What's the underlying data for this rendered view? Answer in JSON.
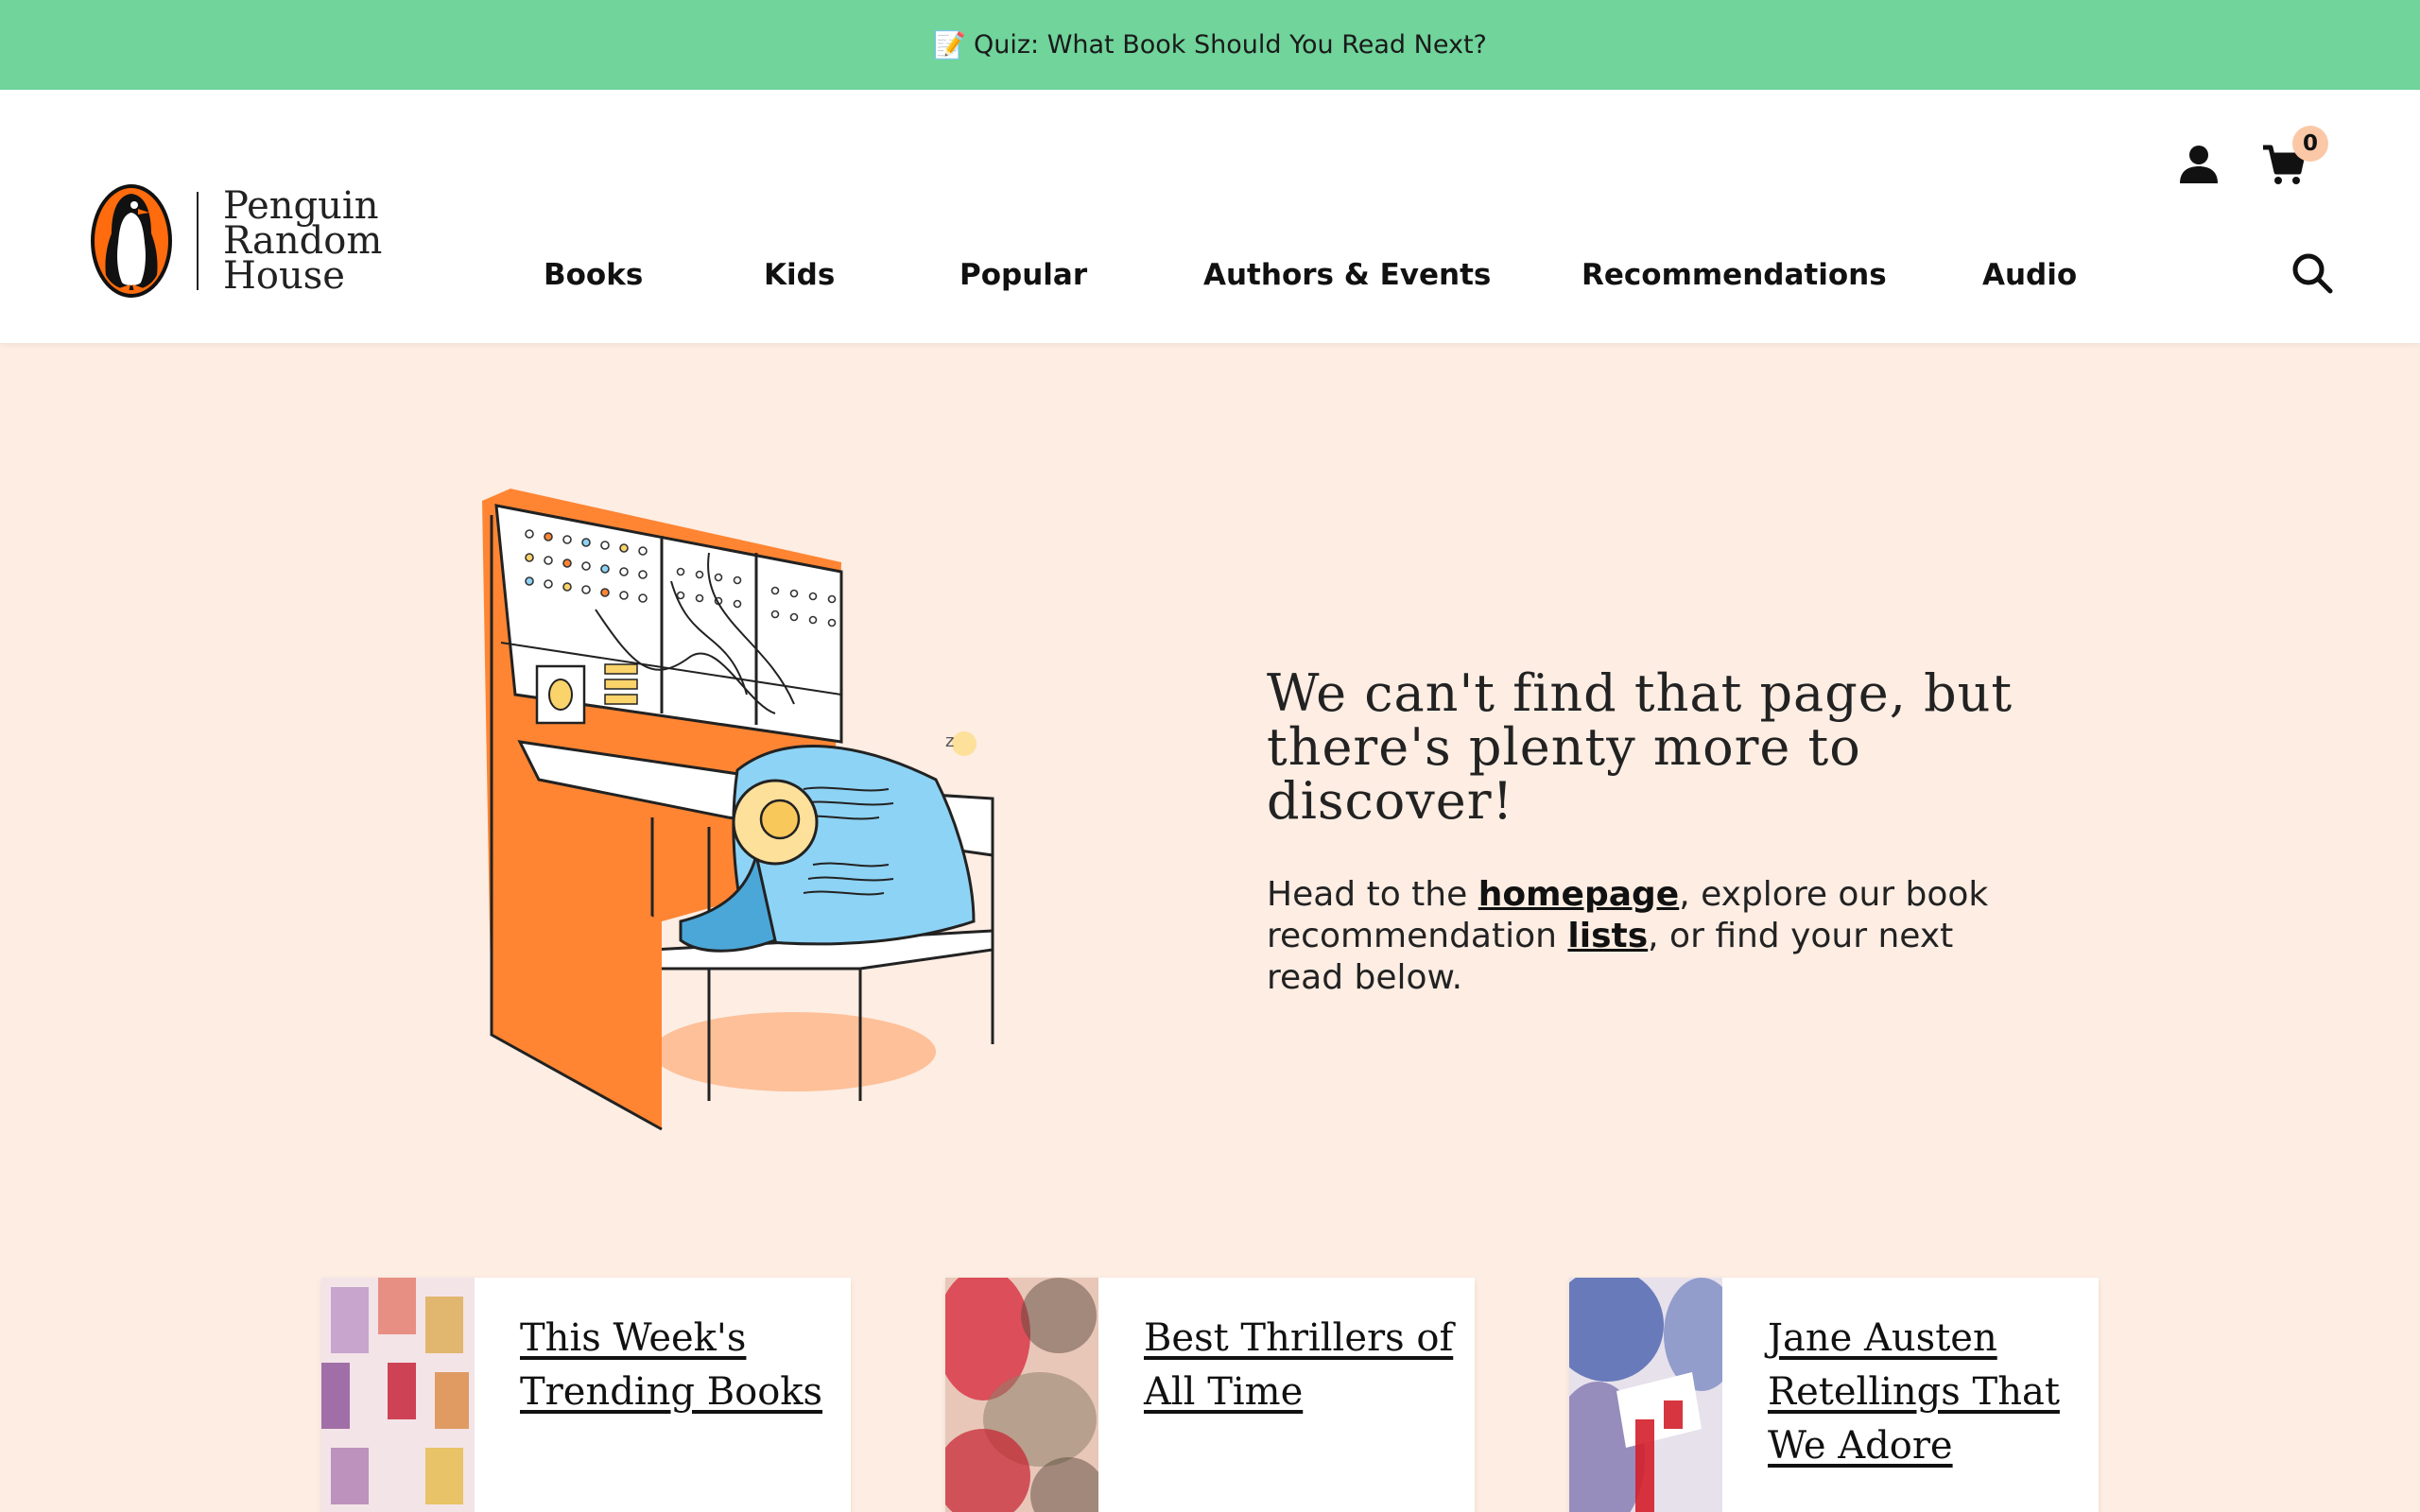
{
  "banner": {
    "emoji": "📝",
    "text": "Quiz: What Book Should You Read Next?"
  },
  "logo": {
    "line1": "Penguin",
    "line2": "Random",
    "line3": "House"
  },
  "nav": {
    "books": "Books",
    "kids": "Kids",
    "popular": "Popular",
    "authors_events": "Authors & Events",
    "recommendations": "Recommendations",
    "audio": "Audio"
  },
  "cart": {
    "count": "0"
  },
  "error": {
    "headline": "We can't find that page, but there's plenty more to discover!",
    "sub_before": "Head to the ",
    "homepage_link": "homepage",
    "sub_middle": ", explore our book recommendation ",
    "lists_link": "lists",
    "sub_after": ", or find your next read below."
  },
  "cards": [
    {
      "title": "This Week's Trending Books"
    },
    {
      "title": "Best Thrillers of All Time"
    },
    {
      "title": "Jane Austen Retellings That We Adore"
    }
  ],
  "colors": {
    "banner": "#70d49b",
    "page_bg": "#fdede3",
    "accent_orange": "#ff8533",
    "accent_blue": "#8dd3f5",
    "badge": "#fbc8a7"
  }
}
